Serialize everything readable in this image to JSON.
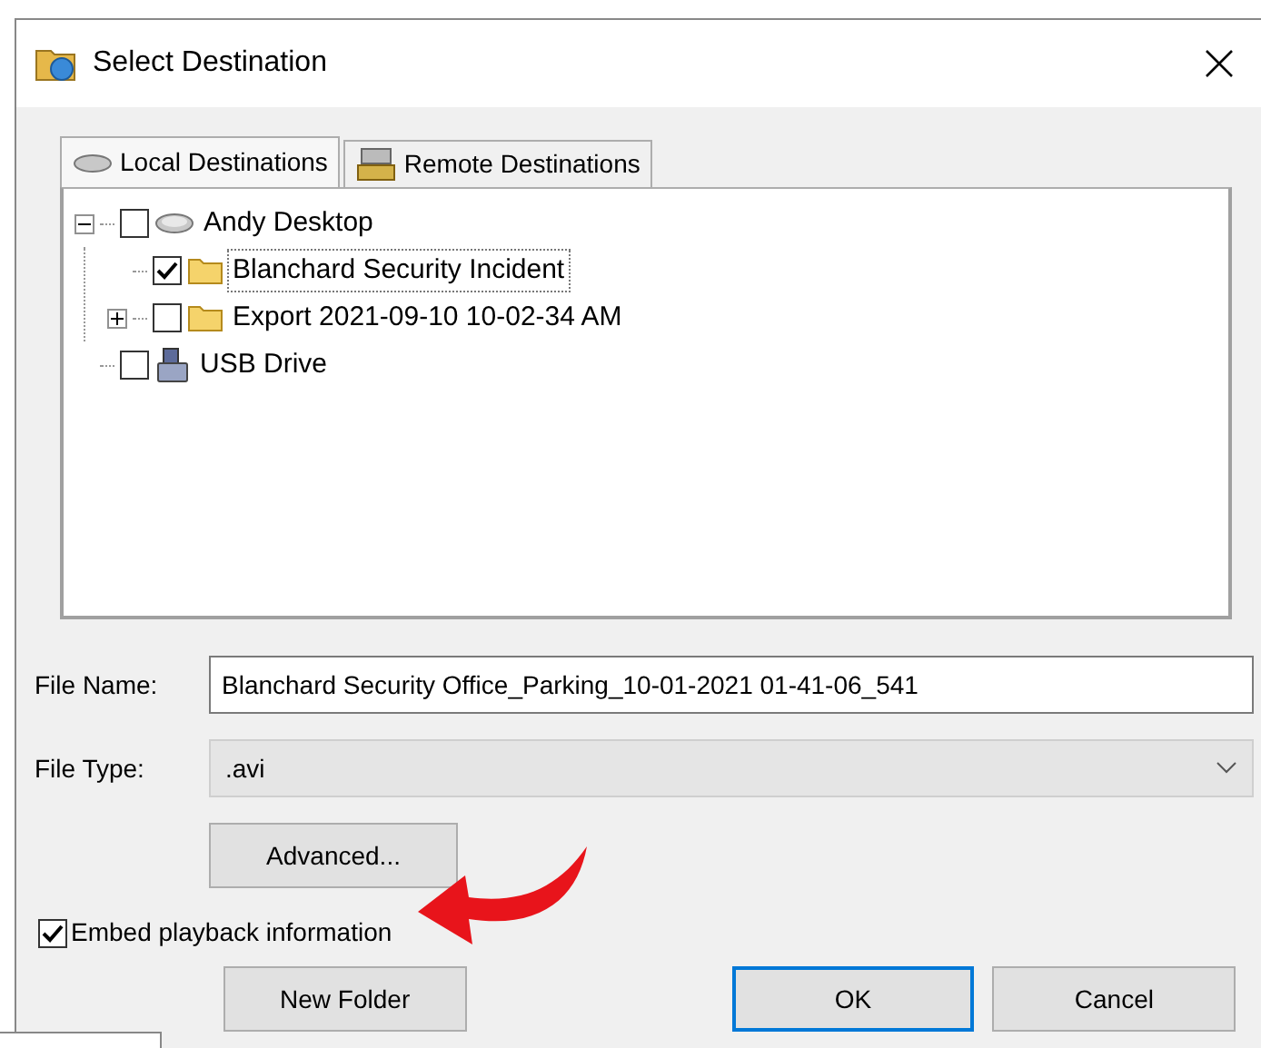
{
  "window": {
    "title": "Select Destination"
  },
  "tabs": [
    {
      "label": "Local Destinations",
      "selected": true,
      "kind": "local"
    },
    {
      "label": "Remote Destinations",
      "selected": false,
      "kind": "remote"
    }
  ],
  "tree": [
    {
      "label": "Andy Desktop",
      "kind": "drive",
      "checked": false,
      "expanded": true,
      "children": [
        {
          "label": "Blanchard Security Incident",
          "kind": "folder",
          "checked": true,
          "selected": true
        },
        {
          "label": "Export 2021-09-10 10-02-34 AM",
          "kind": "folder",
          "checked": false,
          "expanded": false,
          "selected": false
        }
      ]
    },
    {
      "label": "USB Drive",
      "kind": "usb",
      "checked": false,
      "selected": false
    }
  ],
  "file_name": {
    "label": "File Name:",
    "value": "Blanchard Security Office_Parking_10-01-2021 01-41-06_541"
  },
  "file_type": {
    "label": "File Type:",
    "value": ".avi"
  },
  "advanced_button": "Advanced...",
  "embed_checkbox": {
    "label": "Embed playback information",
    "checked": true
  },
  "buttons": [
    {
      "label": "New Folder",
      "default": false
    },
    {
      "label": "OK",
      "default": true
    },
    {
      "label": "Cancel",
      "default": false
    }
  ]
}
